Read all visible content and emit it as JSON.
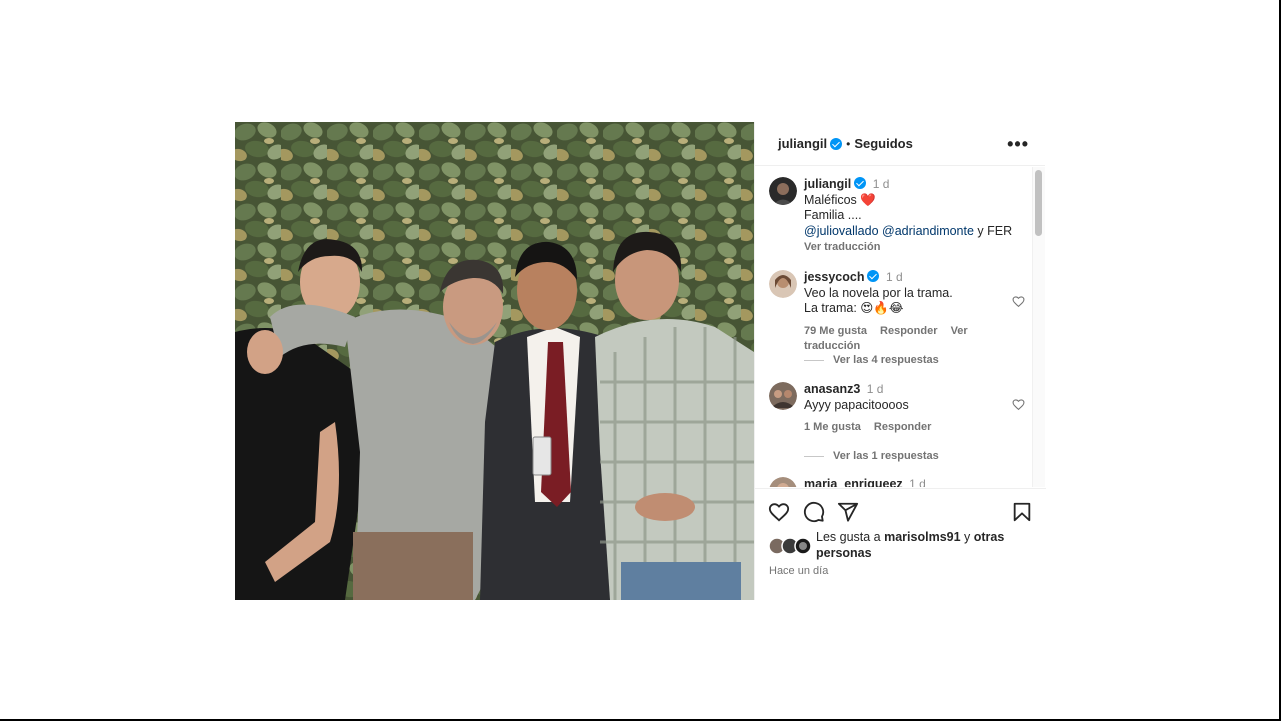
{
  "header": {
    "username": "juliangil",
    "separator": "•",
    "follow_status": "Seguidos",
    "more_label": "•••"
  },
  "caption": {
    "username": "juliangil",
    "time": "1 d",
    "line1": "Maléficos ❤️",
    "line2": "Familia ....",
    "mention1": "@juliovallado",
    "mention2": "@adriandimonte",
    "mention_tail": " y FER",
    "translate": "Ver traducción"
  },
  "comments": [
    {
      "username": "jessycoch",
      "time": "1 d",
      "line1": "Veo la novela por la trama.",
      "line2": "La trama: 😍🔥😂",
      "likes": "79 Me gusta",
      "reply": "Responder",
      "translate": "Ver traducción",
      "replies": "Ver las 4 respuestas"
    },
    {
      "username": "anasanz3",
      "time": "1 d",
      "line1": "Ayyy papacitoooos",
      "likes": "1 Me gusta",
      "reply": "Responder",
      "replies": "Ver las 1 respuestas"
    },
    {
      "username": "maria_enriqueez",
      "time": "1 d"
    }
  ],
  "likes_summary": {
    "prefix": "Les gusta a ",
    "user": "marisolms91",
    "middle": " y ",
    "others": "otras personas"
  },
  "timestamp": "Hace un día",
  "colors": {
    "verified": "#0095f6",
    "link": "#00376b",
    "muted": "#737373",
    "heart": "#ed4956"
  },
  "icons": {
    "like": "heart-icon",
    "comment": "comment-icon",
    "share": "share-icon",
    "save": "bookmark-icon",
    "more": "more-options-icon"
  }
}
